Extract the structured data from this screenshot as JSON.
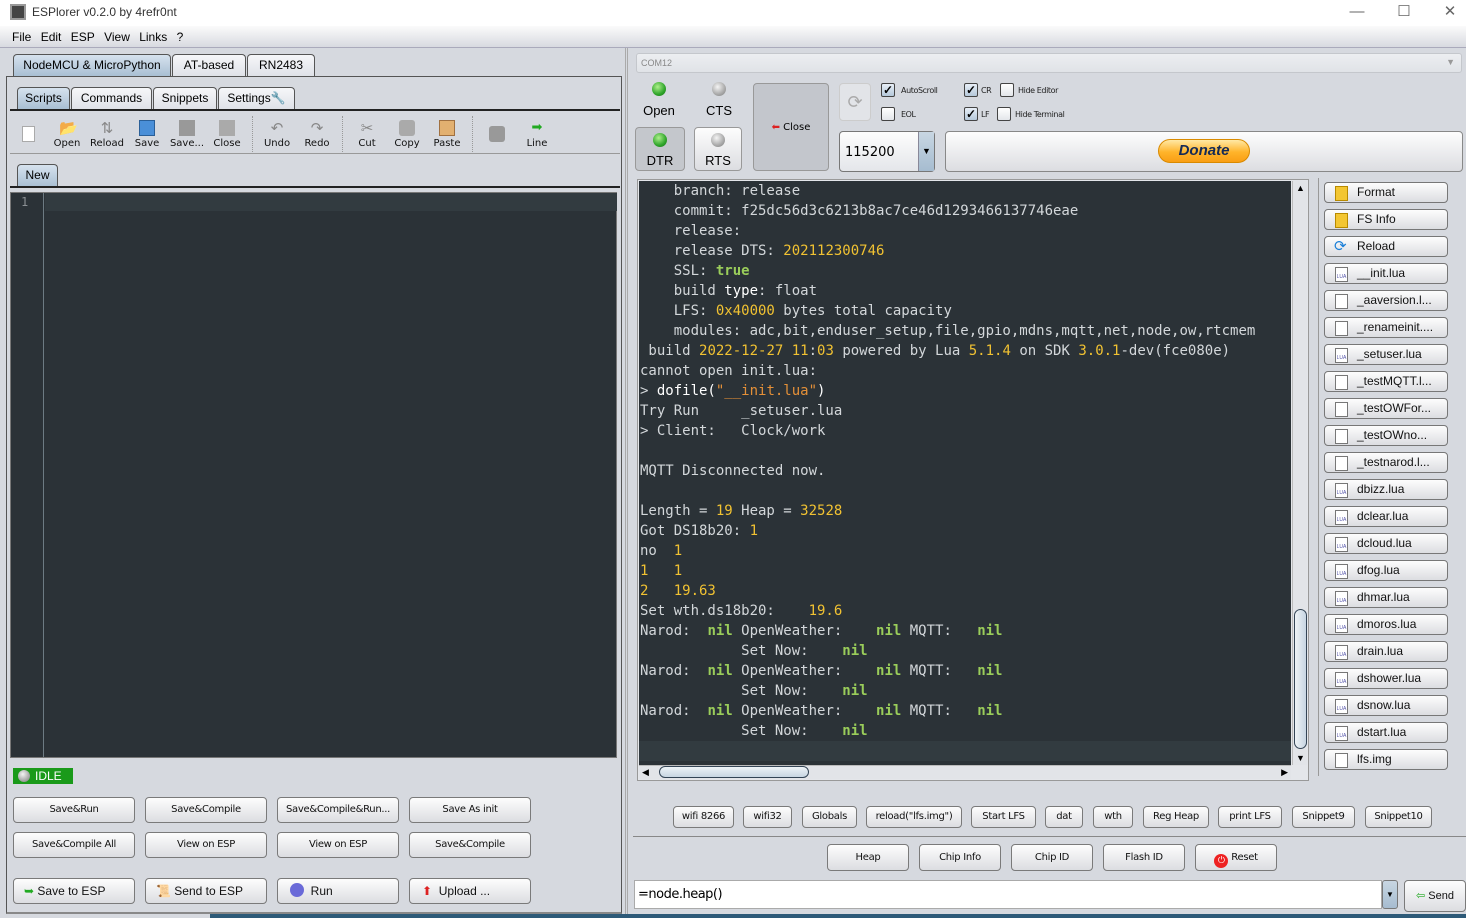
{
  "window": {
    "title": "ESPlorer v0.2.0 by 4refr0nt",
    "minimize": "—",
    "maximize": "☐",
    "close": "✕"
  },
  "menu": [
    "File",
    "Edit",
    "ESP",
    "View",
    "Links",
    "?"
  ],
  "device_tabs": [
    {
      "label": "NodeMCU & MicroPython",
      "active": true
    },
    {
      "label": "AT-based",
      "active": false
    },
    {
      "label": "RN2483",
      "active": false
    }
  ],
  "sub_tabs": [
    {
      "label": "Scripts",
      "active": true
    },
    {
      "label": "Commands",
      "active": false
    },
    {
      "label": "Snippets",
      "active": false
    },
    {
      "label": "Settings",
      "active": false
    }
  ],
  "toolbar": [
    {
      "label": "",
      "icon": "new-file-icon"
    },
    {
      "label": "Open",
      "icon": "folder-open-icon"
    },
    {
      "label": "Reload",
      "icon": "reload-icon"
    },
    {
      "label": "Save",
      "icon": "save-icon"
    },
    {
      "label": "Save...",
      "icon": "save-as-icon"
    },
    {
      "label": "Close",
      "icon": "close-file-icon"
    },
    {
      "label": "Undo",
      "icon": "undo-icon"
    },
    {
      "label": "Redo",
      "icon": "redo-icon"
    },
    {
      "label": "Cut",
      "icon": "cut-icon"
    },
    {
      "label": "Copy",
      "icon": "copy-icon"
    },
    {
      "label": "Paste",
      "icon": "paste-icon"
    },
    {
      "label": "",
      "icon": "send-line-icon"
    },
    {
      "label": "Line",
      "icon": "line-icon"
    }
  ],
  "editor": {
    "tab": "New",
    "line_numbers": [
      "1"
    ]
  },
  "status": {
    "label": "IDLE",
    "color": "#1a9a1a"
  },
  "script_buttons_row1": [
    "Save&Run",
    "Save&Compile",
    "Save&Compile&Run...",
    "Save As init"
  ],
  "script_buttons_row2": [
    "Save&Compile All",
    "View on ESP",
    "View on ESP",
    "Save&Compile"
  ],
  "script_buttons_row3": [
    {
      "label": "Save to ESP",
      "icon": "save-to-esp-icon"
    },
    {
      "label": "Send to ESP",
      "icon": "send-to-esp-icon"
    },
    {
      "label": "Run",
      "icon": "run-icon"
    },
    {
      "label": "Upload ...",
      "icon": "upload-icon"
    }
  ],
  "port": {
    "value": "COM12"
  },
  "leds": [
    {
      "label": "Open",
      "on": true
    },
    {
      "label": "CTS",
      "on": false
    },
    {
      "label": "DTR",
      "on": true
    },
    {
      "label": "RTS",
      "on": false
    }
  ],
  "close_button": "Close",
  "checkboxes": [
    {
      "label": "AutoScroll",
      "checked": true
    },
    {
      "label": "EOL",
      "checked": false
    },
    {
      "label": "CR",
      "checked": true
    },
    {
      "label": "LF",
      "checked": true
    },
    {
      "label": "Hide Editor",
      "checked": false
    },
    {
      "label": "Hide Terminal",
      "checked": false
    }
  ],
  "baud": {
    "value": "115200"
  },
  "donate": "Donate",
  "terminal_lines": [
    [
      [
        "    branch: release",
        ""
      ]
    ],
    [
      [
        "    commit: f25dc56d3c6213b8ac7ce46d1293466137746eae",
        ""
      ]
    ],
    [
      [
        "    release:",
        ""
      ]
    ],
    [
      [
        "    release DTS: ",
        ""
      ],
      [
        "202112300746",
        "y"
      ]
    ],
    [
      [
        "    SSL: ",
        ""
      ],
      [
        "true",
        "g"
      ]
    ],
    [
      [
        "    build ",
        ""
      ],
      [
        "type",
        "w"
      ],
      [
        ": float",
        ""
      ]
    ],
    [
      [
        "    LFS: ",
        ""
      ],
      [
        "0x40000",
        "y"
      ],
      [
        " bytes total capacity",
        ""
      ]
    ],
    [
      [
        "    modules: adc,bit,enduser_setup,file,gpio,mdns,mqtt,net,node,ow,rtcmem",
        ""
      ]
    ],
    [
      [
        " build ",
        ""
      ],
      [
        "2022-12-27 11",
        "y"
      ],
      [
        ":",
        ""
      ],
      [
        "03",
        "y"
      ],
      [
        " powered by Lua ",
        ""
      ],
      [
        "5.1.4",
        "y"
      ],
      [
        " on SDK ",
        ""
      ],
      [
        "3.0.1",
        "y"
      ],
      [
        "-dev(fce080e)",
        ""
      ]
    ],
    [
      [
        "cannot open init.lua:",
        ""
      ]
    ],
    [
      [
        "> ",
        ""
      ],
      [
        "dofile(",
        "w"
      ],
      [
        "\"__init.lua\"",
        "o"
      ],
      [
        ")",
        "w"
      ]
    ],
    [
      [
        "Try Run     _setuser.lua",
        ""
      ]
    ],
    [
      [
        "> Client:   Clock/work",
        ""
      ]
    ],
    [
      [
        "",
        ""
      ]
    ],
    [
      [
        "MQTT Disconnected now.",
        ""
      ]
    ],
    [
      [
        "",
        ""
      ]
    ],
    [
      [
        "Length = ",
        ""
      ],
      [
        "19",
        "y"
      ],
      [
        " Heap = ",
        ""
      ],
      [
        "32528",
        "y"
      ]
    ],
    [
      [
        "Got DS18b20: ",
        ""
      ],
      [
        "1",
        "y"
      ]
    ],
    [
      [
        "no  ",
        ""
      ],
      [
        "1",
        "y"
      ]
    ],
    [
      [
        "1   1",
        "y"
      ]
    ],
    [
      [
        "2   19.63",
        "y"
      ]
    ],
    [
      [
        "Set wth.ds18b20:    ",
        ""
      ],
      [
        "19.6",
        "y"
      ]
    ],
    [
      [
        "Narod:  ",
        ""
      ],
      [
        "nil",
        "g"
      ],
      [
        " OpenWeather:    ",
        ""
      ],
      [
        "nil",
        "g"
      ],
      [
        " MQTT:   ",
        ""
      ],
      [
        "nil",
        "g"
      ]
    ],
    [
      [
        "            Set Now:    ",
        ""
      ],
      [
        "nil",
        "g"
      ]
    ],
    [
      [
        "Narod:  ",
        ""
      ],
      [
        "nil",
        "g"
      ],
      [
        " OpenWeather:    ",
        ""
      ],
      [
        "nil",
        "g"
      ],
      [
        " MQTT:   ",
        ""
      ],
      [
        "nil",
        "g"
      ]
    ],
    [
      [
        "            Set Now:    ",
        ""
      ],
      [
        "nil",
        "g"
      ]
    ],
    [
      [
        "Narod:  ",
        ""
      ],
      [
        "nil",
        "g"
      ],
      [
        " OpenWeather:    ",
        ""
      ],
      [
        "nil",
        "g"
      ],
      [
        " MQTT:   ",
        ""
      ],
      [
        "nil",
        "g"
      ]
    ],
    [
      [
        "            Set Now:    ",
        ""
      ],
      [
        "nil",
        "g"
      ]
    ]
  ],
  "fs_buttons": [
    {
      "label": "Format",
      "icon": "format-icon"
    },
    {
      "label": "FS Info",
      "icon": "fs-info-icon"
    },
    {
      "label": "Reload",
      "icon": "reload-icon"
    }
  ],
  "files": [
    "__init.lua",
    "_aaversion.l...",
    "_renameinit....",
    "_setuser.lua",
    "_testMQTT.l...",
    "_testOWFor...",
    "_testOWno...",
    "_testnarod.l...",
    "dbizz.lua",
    "dclear.lua",
    "dcloud.lua",
    "dfog.lua",
    "dhmar.lua",
    "dmoros.lua",
    "drain.lua",
    "dshower.lua",
    "dsnow.lua",
    "dstart.lua",
    "lfs.img"
  ],
  "snippets": [
    "wifi 8266",
    "wifi32",
    "Globals",
    "reload(\"lfs.img\")",
    "Start LFS",
    "dat",
    "wth",
    "Reg Heap",
    "print LFS",
    "Snippet9",
    "Snippet10"
  ],
  "commands": [
    "Heap",
    "Chip Info",
    "Chip ID",
    "Flash ID",
    "Reset"
  ],
  "command_input": {
    "value": "=node.heap()"
  },
  "send": "Send"
}
